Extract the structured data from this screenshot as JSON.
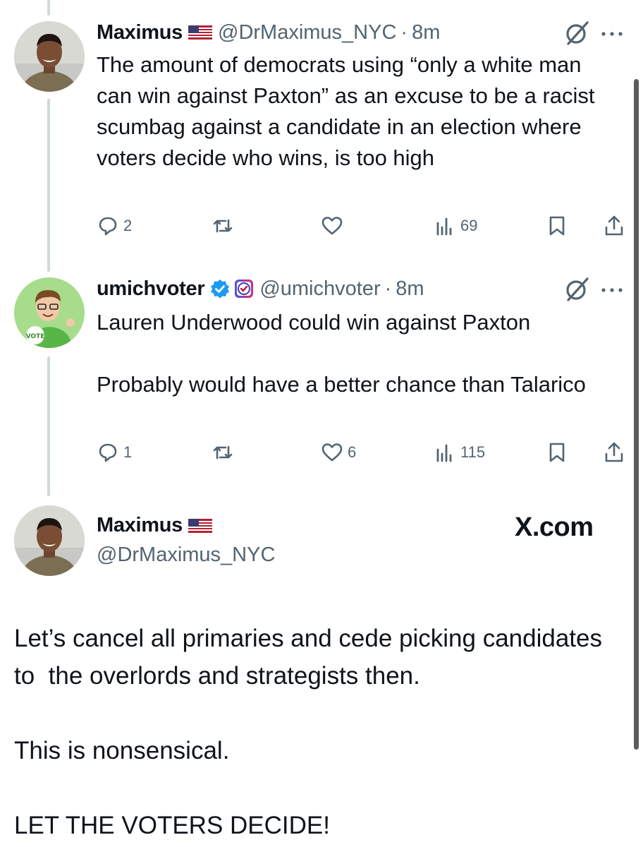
{
  "tweets": [
    {
      "name": "Maximus",
      "handle": "@DrMaximus_NYC",
      "time": "8m",
      "text": "The amount of democrats using “only a white man can win against Paxton” as an excuse to be a racist scumbag against a candidate in an election where voters decide who wins, is too high",
      "replies": "2",
      "reposts": "",
      "likes": "",
      "views": "69"
    },
    {
      "name": "umichvoter",
      "handle": "@umichvoter",
      "time": "8m",
      "text": "Lauren Underwood could win against Paxton\n\nProbably would have a better chance than Talarico",
      "replies": "1",
      "reposts": "",
      "likes": "6",
      "views": "115"
    }
  ],
  "quote": {
    "name": "Maximus",
    "handle": "@DrMaximus_NYC",
    "source": "X.com",
    "text": "Let’s cancel all primaries and cede picking candidates to  the overlords and strategists then.\n\nThis is nonsensical.\n\nLET THE VOTERS DECIDE!"
  },
  "separator": "·",
  "avatar_badge": "VOTE",
  "icons": [
    "reply-icon",
    "repost-icon",
    "like-icon",
    "views-icon",
    "bookmark-icon",
    "share-icon",
    "grok-icon",
    "more-icon",
    "verified-icon",
    "flag-icon"
  ],
  "colors": {
    "text": "#0f1419",
    "secondary": "#536471",
    "verified": "#1d9bf0",
    "thread_line": "#cfd9de"
  }
}
